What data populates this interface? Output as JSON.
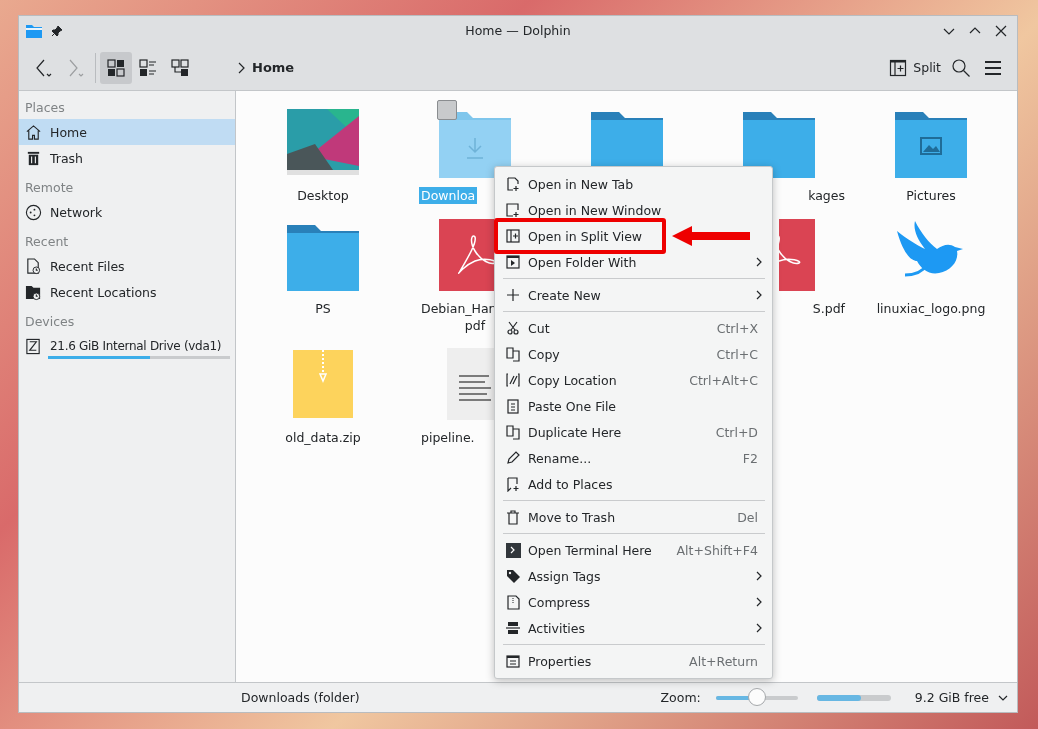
{
  "window": {
    "title": "Home — Dolphin"
  },
  "toolbar": {
    "back_disabled": false,
    "forward_disabled": true,
    "view_modes": [
      {
        "selected": true
      },
      {
        "selected": false
      },
      {
        "selected": false
      }
    ],
    "breadcrumb": "Home",
    "split_label": "Split"
  },
  "sidebar": {
    "sections": [
      {
        "heading": "Places",
        "items": [
          {
            "label": "Home",
            "selected": true
          },
          {
            "label": "Trash",
            "selected": false
          }
        ]
      },
      {
        "heading": "Remote",
        "items": [
          {
            "label": "Network",
            "selected": false
          }
        ]
      },
      {
        "heading": "Recent",
        "items": [
          {
            "label": "Recent Files",
            "selected": false
          },
          {
            "label": "Recent Locations",
            "selected": false
          }
        ]
      },
      {
        "heading": "Devices",
        "items": [
          {
            "label": "21.6 GiB Internal Drive (vda1)",
            "selected": false,
            "level": 0.56
          }
        ]
      }
    ]
  },
  "files": [
    {
      "kind": "wallpaper",
      "label": "Desktop",
      "selected": false
    },
    {
      "kind": "downloads-folder",
      "label": "Downloa",
      "selected": true,
      "cut_end": true
    },
    {
      "kind": "folder",
      "selected": false
    },
    {
      "kind": "folder",
      "label": "kages",
      "selected": false,
      "cut_start": true
    },
    {
      "kind": "pictures-folder",
      "label": "Pictures",
      "selected": false
    },
    {
      "kind": "folder",
      "label": "PS",
      "selected": false
    },
    {
      "kind": "pdf",
      "label": "Debian_Han",
      "label_line_2": "pdf",
      "selected": false,
      "cut_end": true
    },
    {
      "kind": "pdf",
      "label": "S.pdf",
      "selected": false,
      "cut_start": true
    },
    {
      "kind": "bird-image",
      "label": "linuxiac_logo.png",
      "selected": false
    },
    {
      "kind": "archive",
      "label": "old_data.zip",
      "selected": false
    },
    {
      "kind": "text",
      "label": "pipeline.",
      "selected": false,
      "cut_end": true
    }
  ],
  "context_menu": [
    {
      "kind": "item",
      "label": "Open in New Tab"
    },
    {
      "kind": "item",
      "label": "Open in New Window"
    },
    {
      "kind": "item",
      "label": "Open in Split View",
      "highlighted": true
    },
    {
      "kind": "item",
      "label": "Open Folder With",
      "submenu": true
    },
    {
      "kind": "separator"
    },
    {
      "kind": "item",
      "label": "Create New",
      "submenu": true
    },
    {
      "kind": "separator"
    },
    {
      "kind": "item",
      "label": "Cut",
      "shortcut": "Ctrl+X"
    },
    {
      "kind": "item",
      "label": "Copy",
      "shortcut": "Ctrl+C"
    },
    {
      "kind": "item",
      "label": "Copy Location",
      "shortcut": "Ctrl+Alt+C"
    },
    {
      "kind": "item",
      "label": "Paste One File"
    },
    {
      "kind": "item",
      "label": "Duplicate Here",
      "shortcut": "Ctrl+D"
    },
    {
      "kind": "item",
      "label": "Rename...",
      "shortcut": "F2"
    },
    {
      "kind": "item",
      "label": "Add to Places"
    },
    {
      "kind": "separator"
    },
    {
      "kind": "item",
      "label": "Move to Trash",
      "shortcut": "Del"
    },
    {
      "kind": "separator"
    },
    {
      "kind": "item",
      "label": "Open Terminal Here",
      "shortcut": "Alt+Shift+F4"
    },
    {
      "kind": "item",
      "label": "Assign Tags",
      "submenu": true
    },
    {
      "kind": "item",
      "label": "Compress",
      "submenu": true
    },
    {
      "kind": "item",
      "label": "Activities",
      "submenu": true
    },
    {
      "kind": "separator"
    },
    {
      "kind": "item",
      "label": "Properties",
      "shortcut": "Alt+Return"
    }
  ],
  "status_bar": {
    "text": "Downloads (folder)",
    "zoom_label": "Zoom:",
    "zoom": {
      "level": 0.5
    },
    "space": {
      "level": 0.6
    },
    "free": "9.2 GiB free"
  }
}
